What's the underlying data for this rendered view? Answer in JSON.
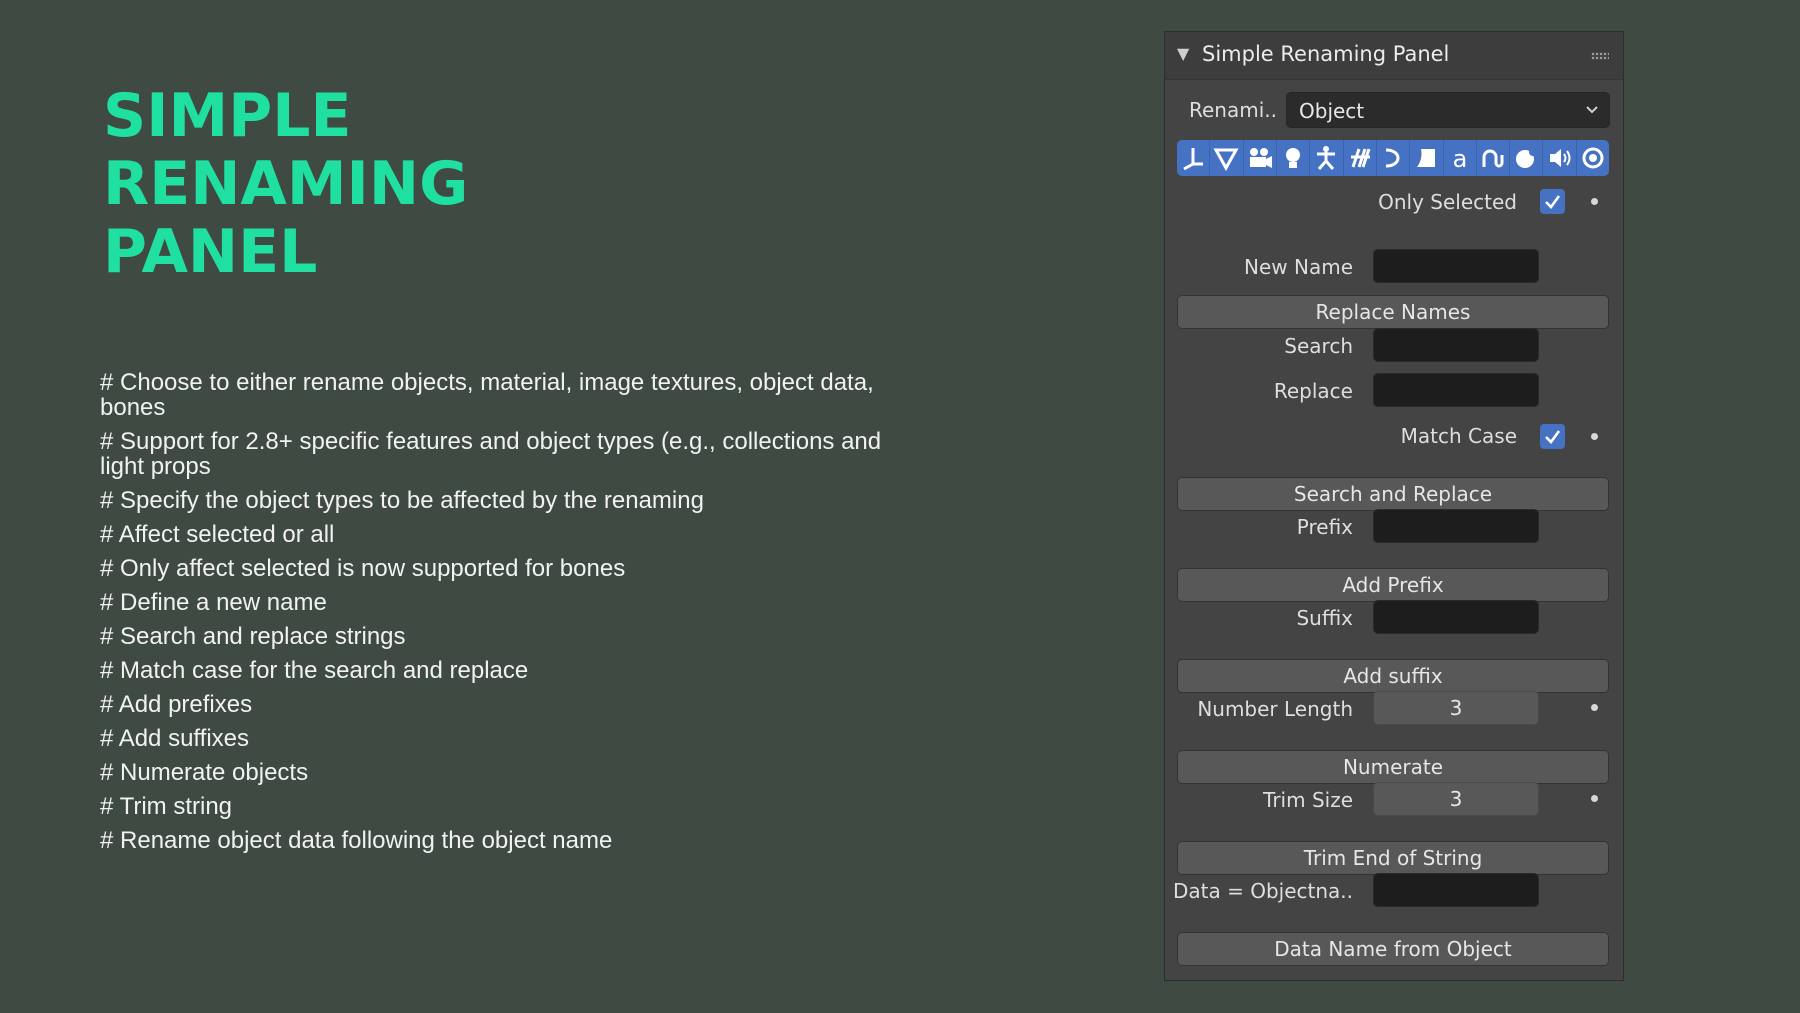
{
  "headline": [
    "SIMPLE",
    "RENAMING",
    "PANEL"
  ],
  "features": [
    "# Choose to either rename objects, material, image textures, object data, bones",
    "# Support for 2.8+ specific features and object types (e.g., collections and light props",
    "# Specify the object types to be affected by the renaming",
    "# Affect selected or all",
    "# Only affect selected is now supported for bones",
    "# Define a new name",
    "# Search and replace strings",
    "# Match case for the search and replace",
    "# Add prefixes",
    "# Add suffixes",
    "# Numerate objects",
    "# Trim string",
    "# Rename object data following the object name"
  ],
  "panel": {
    "title": "Simple Renaming Panel",
    "rename_label": "Renami..",
    "rename_type": "Object",
    "type_icons": [
      "empty-icon",
      "mesh-icon",
      "camera-icon",
      "light-icon",
      "armature-icon",
      "lattice-icon",
      "curve-icon",
      "surface-icon",
      "text-icon",
      "metaball-icon",
      "force-field-icon",
      "speaker-icon",
      "light-probe-icon"
    ],
    "accent_color": "#4672c4",
    "only_selected_label": "Only Selected",
    "only_selected": true,
    "new_name_label": "New Name",
    "new_name_value": "",
    "replace_names_button": "Replace Names",
    "search_label": "Search",
    "search_value": "",
    "replace_label": "Replace",
    "replace_value": "",
    "match_case_label": "Match Case",
    "match_case": true,
    "search_replace_button": "Search and Replace",
    "prefix_label": "Prefix",
    "prefix_value": "",
    "add_prefix_button": "Add Prefix",
    "suffix_label": "Suffix",
    "suffix_value": "",
    "add_suffix_button": "Add suffix",
    "number_length_label": "Number Length",
    "number_length": "3",
    "numerate_button": "Numerate",
    "trim_size_label": "Trim Size",
    "trim_size": "3",
    "trim_button": "Trim End of String",
    "data_label": "Data = Objectna..",
    "data_value": "",
    "data_name_button": "Data Name from Object"
  },
  "colors": {
    "background": "#3e4a42",
    "headline": "#1fe0a0",
    "panel": "#444444"
  }
}
